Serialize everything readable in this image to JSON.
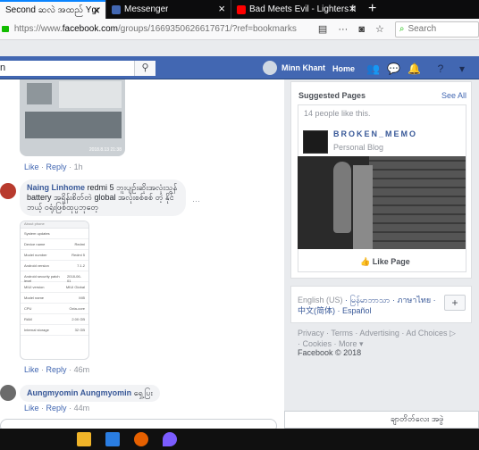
{
  "browser": {
    "tabs": [
      {
        "title": "Second ဆလဲ အထည် Ygn",
        "close": "×",
        "favicon_color": "#4267b2"
      },
      {
        "title": "Messenger",
        "close": "×",
        "favicon_color": "#4267b2"
      },
      {
        "title": "Bad Meets Evil - Lighters ft. Br",
        "close": "×",
        "favicon_color": "#ff0000"
      }
    ],
    "new_tab": "+",
    "url_prefix": "https://www.",
    "url_domain": "facebook.com",
    "url_rest": "/groups/1669350626617671/?ref=bookmarks",
    "menu_dots": "···",
    "search_placeholder": "Search"
  },
  "fb": {
    "search_value": "n",
    "search_icon": "magnifier-icon",
    "user_name": "Minn Khant",
    "home_label": "Home",
    "accent": "#4267b2"
  },
  "feed": {
    "photo_stamp": "2018.8.13 21:38",
    "c1_actions": {
      "like": "Like",
      "sep": "·",
      "reply": "Reply",
      "time": "1h"
    },
    "c2": {
      "author": "Naing Linhome",
      "text": "redmi 5 ဘူးပျဉ်းဆိုးအလုံးသွန် battery အရှိန်းစိတ်တဲ global အလုံးစစ်စစ် တဲ့ နိုင်ဘယ့် ဝရုံးဖြစ်ထုပ္ပဘုတေ့",
      "more": "···",
      "actions": {
        "like": "Like",
        "sep": "·",
        "reply": "Reply",
        "time": "46m"
      }
    },
    "screenshot_rows": [
      {
        "k": "System updates",
        "v": ""
      },
      {
        "k": "Device name",
        "v": "Redmi"
      },
      {
        "k": "Model number",
        "v": "Redmi 5"
      },
      {
        "k": "Android version",
        "v": "7.1.2"
      },
      {
        "k": "Android security patch level",
        "v": "2018-06-01"
      },
      {
        "k": "MIUI version",
        "v": "MIUI Global"
      },
      {
        "k": "Model name",
        "v": "MI5"
      },
      {
        "k": "CPU",
        "v": "Octa-core"
      },
      {
        "k": "RAM",
        "v": "2.00 GB"
      },
      {
        "k": "Internal storage",
        "v": "32 GB"
      }
    ],
    "screenshot_header": "About phone",
    "c3": {
      "author": "Aungmyomin Aungmyomin",
      "text": "ရှေ့ပြး",
      "actions": {
        "like": "Like",
        "sep": "·",
        "reply": "Reply",
        "time": "44m"
      }
    }
  },
  "right": {
    "suggested_title": "Suggested Pages",
    "see_all": "See All",
    "like_count": "14 people like this.",
    "page_name": "BROKEN_MEMO",
    "page_category": "Personal Blog",
    "like_page": "Like Page",
    "languages": {
      "current": "English (US)",
      "list": [
        "မြန်မာဘာသာ",
        "ภาษาไทย",
        "中文(简体)",
        "Español"
      ]
    },
    "plus": "+",
    "footer_links": [
      "Privacy",
      "Terms",
      "Advertising",
      "Ad Choices",
      "Cookies",
      "More"
    ],
    "copyright": "Facebook © 2018",
    "chat_label": "ချာတိတ်လေး အဖွဲ"
  }
}
